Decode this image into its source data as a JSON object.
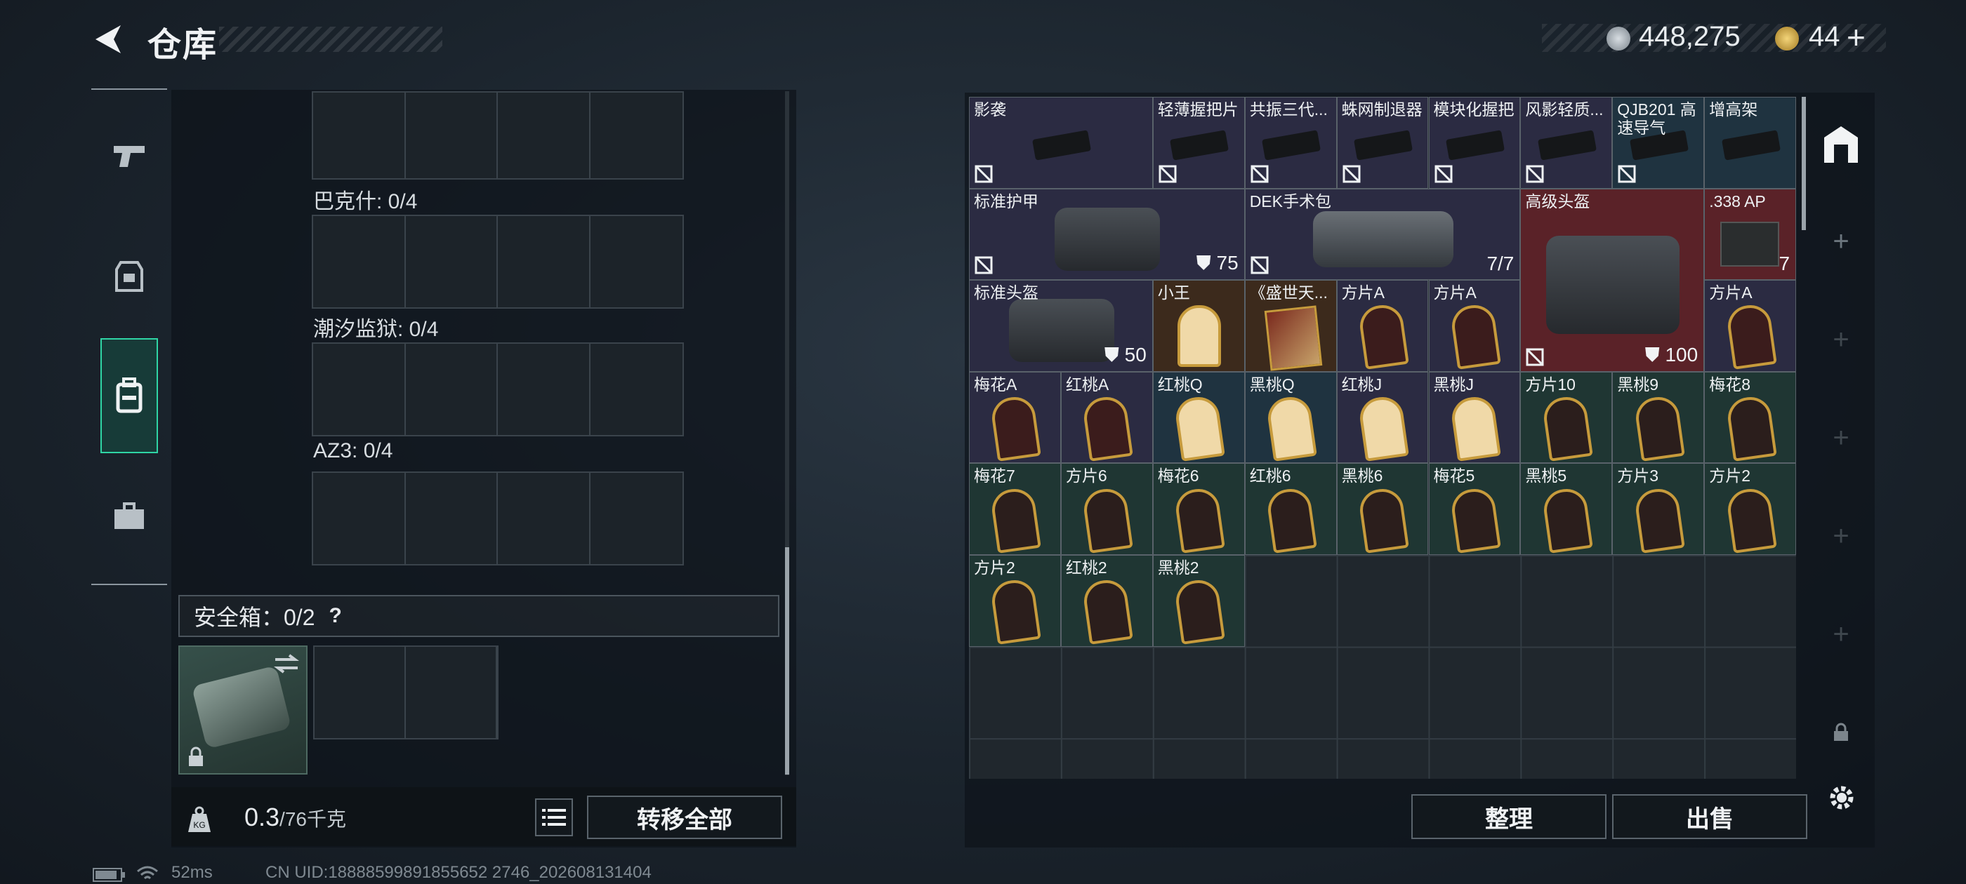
{
  "header": {
    "title": "仓库"
  },
  "currency": {
    "silver": "448,275",
    "gold": "44"
  },
  "left": {
    "sections": [
      {
        "label": "巴克什: 0/4"
      },
      {
        "label": "潮汐监狱: 0/4"
      },
      {
        "label": "AZ3: 0/4"
      }
    ],
    "safe_label": "安全箱：0/2",
    "help": "?",
    "weight_value": "0.3",
    "weight_max": "/76千克",
    "transfer_all": "转移全部"
  },
  "right": {
    "sort": "整理",
    "sell": "出售",
    "items": [
      {
        "name": "影袭"
      },
      {
        "name": "轻薄握把片"
      },
      {
        "name": "共振三代..."
      },
      {
        "name": "蛛网制退器"
      },
      {
        "name": "模块化握把"
      },
      {
        "name": "风影轻质..."
      },
      {
        "name": "QJB201 高速导气"
      },
      {
        "name": "增高架"
      },
      {
        "name": "标准护甲",
        "qty": "75"
      },
      {
        "name": "DEK手术包",
        "qty": "7/7"
      },
      {
        "name": "高级头盔",
        "qty": "100"
      },
      {
        "name": ".338 AP",
        "qty": "7"
      },
      {
        "name": "标准头盔",
        "qty": "50"
      },
      {
        "name": "小王"
      },
      {
        "name": "《盛世天..."
      },
      {
        "name": "方片A"
      },
      {
        "name": "方片A"
      },
      {
        "name": "方片A"
      },
      {
        "name": "梅花A"
      },
      {
        "name": "红桃A"
      },
      {
        "name": "红桃Q"
      },
      {
        "name": "黑桃Q"
      },
      {
        "name": "红桃J"
      },
      {
        "name": "黑桃J"
      },
      {
        "name": "方片10"
      },
      {
        "name": "黑桃9"
      },
      {
        "name": "梅花8"
      },
      {
        "name": "梅花7"
      },
      {
        "name": "方片6"
      },
      {
        "name": "梅花6"
      },
      {
        "name": "红桃6"
      },
      {
        "name": "黑桃6"
      },
      {
        "name": "梅花5"
      },
      {
        "name": "黑桃5"
      },
      {
        "name": "方片3"
      },
      {
        "name": "方片2"
      },
      {
        "name": "方片2"
      },
      {
        "name": "红桃2"
      },
      {
        "name": "黑桃2"
      }
    ]
  },
  "status": {
    "ping": "52ms",
    "uid": "CN UID:18888599891855652 2746_202608131404"
  },
  "colors": {
    "accent": "#2fd5a5",
    "armor_red": "#5a2228"
  }
}
